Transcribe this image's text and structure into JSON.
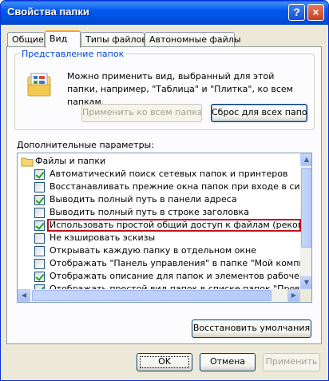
{
  "window": {
    "title": "Свойства папки",
    "help_label": "?",
    "close_label": "×"
  },
  "tabs": [
    {
      "label": "Общие",
      "active": false
    },
    {
      "label": "Вид",
      "active": true
    },
    {
      "label": "Типы файлов",
      "active": false
    },
    {
      "label": "Автономные файлы",
      "active": false
    }
  ],
  "folder_view": {
    "legend": "Представление папок",
    "description": "Можно применить вид, выбранный для этой папки, например, \"Таблица\" и \"Плитка\", ко всем папкам.",
    "apply_all_label": "Применить ко всем папкам",
    "reset_all_label": "Сброс для всех папок"
  },
  "advanced": {
    "label": "Дополнительные параметры:",
    "root_label": "Файлы и папки",
    "items": [
      {
        "label": "Автоматический поиск сетевых папок и принтеров",
        "checked": true
      },
      {
        "label": "Восстанавливать прежние окна папок при входе в систему",
        "checked": false
      },
      {
        "label": "Выводить полный путь в панели адреса",
        "checked": true
      },
      {
        "label": "Выводить полный путь в строке заголовка",
        "checked": false
      },
      {
        "label": "Использовать простой общий доступ к файлам (рекомендуется)",
        "checked": true
      },
      {
        "label": "Не кэшировать эскизы",
        "checked": false
      },
      {
        "label": "Открывать каждую папку в отдельном окне",
        "checked": false
      },
      {
        "label": "Отображать \"Панель управления\" в папке \"Мой компьютер\"",
        "checked": false
      },
      {
        "label": "Отображать описание для папок и элементов рабочего стола",
        "checked": true
      },
      {
        "label": "Отображать простой вид папок в списке папок \"Проводника\"",
        "checked": true
      }
    ],
    "restore_defaults_label": "Восстановить умолчания"
  },
  "footer": {
    "ok_label": "OK",
    "cancel_label": "Отмена",
    "apply_label": "Применить"
  },
  "colors": {
    "titlebar": "#0058ee",
    "highlight_border": "#c01020",
    "legend_text": "#0046d5",
    "checkmark": "#21a121"
  }
}
